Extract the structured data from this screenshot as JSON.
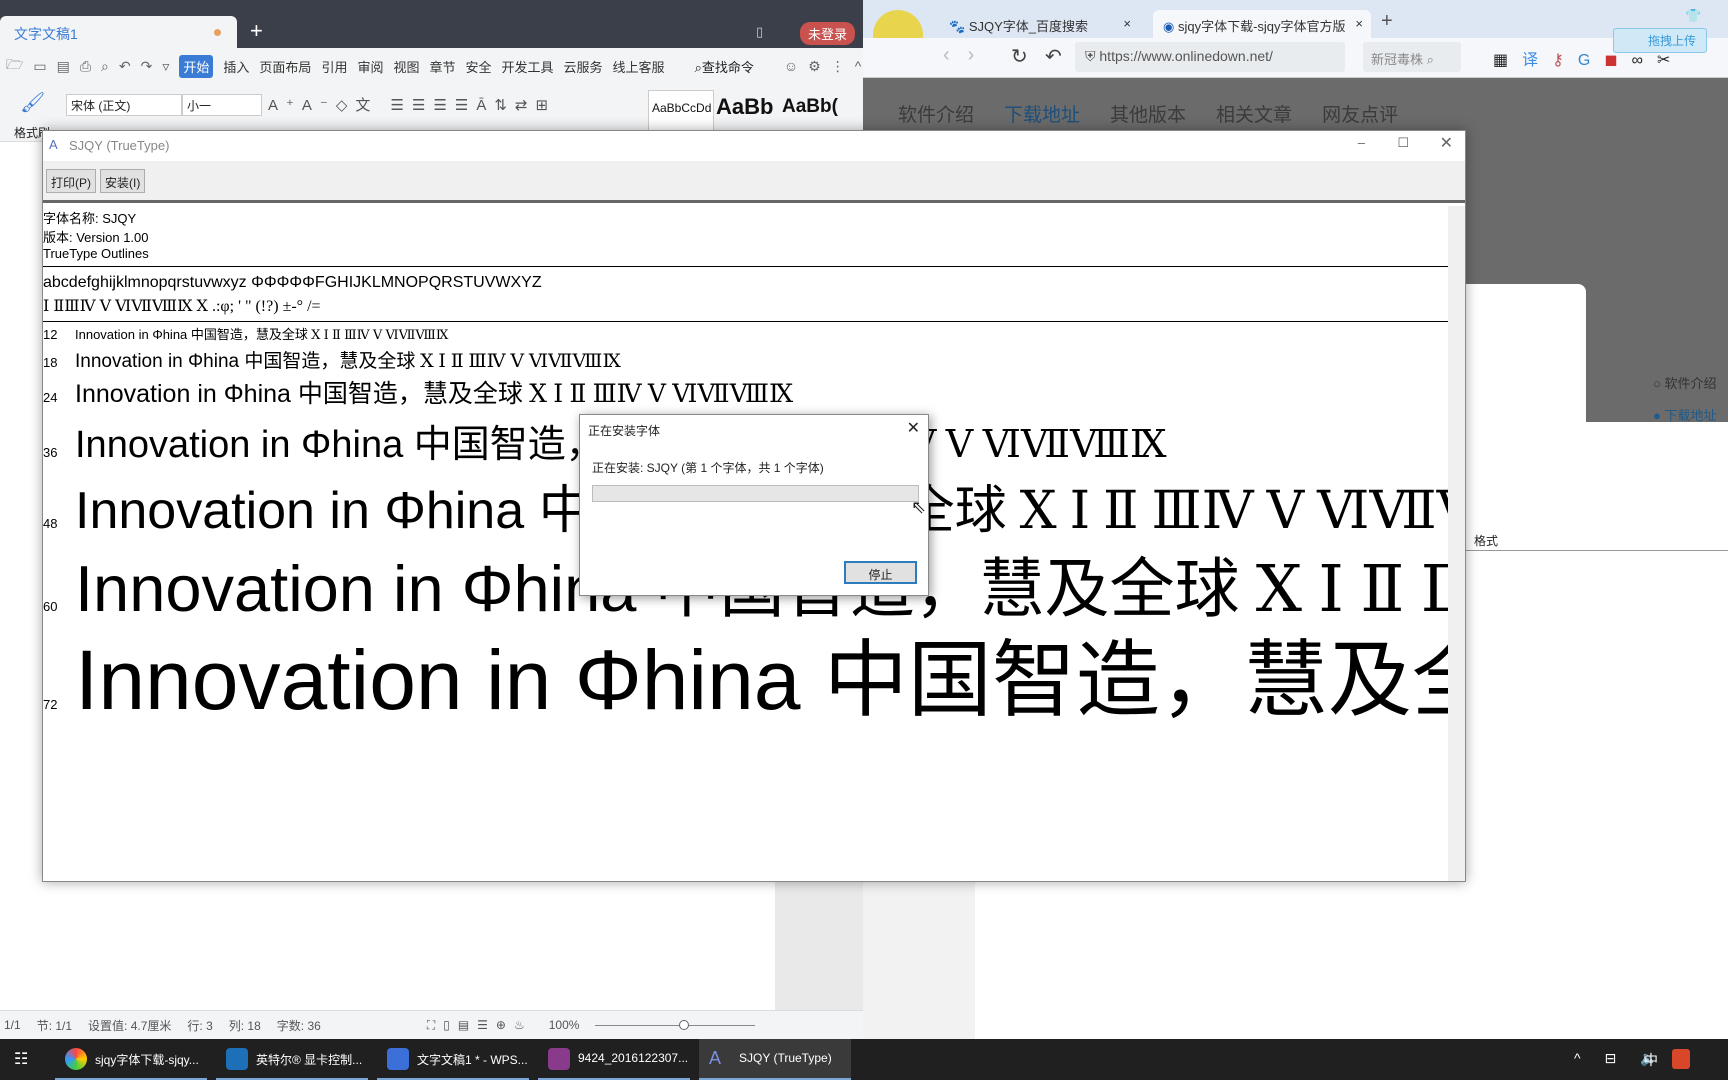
{
  "wps": {
    "tab_title": "文字文稿1",
    "login": "未登录",
    "menu": [
      "开始",
      "插入",
      "页面布局",
      "引用",
      "审阅",
      "视图",
      "章节",
      "安全",
      "开发工具",
      "云服务",
      "线上客服"
    ],
    "find_cmd": "查找命令",
    "font_name": "宋体 (正文)",
    "font_size": "小一",
    "format_painter": "格式刷",
    "styles": [
      "AaBbCcDd",
      "AaBb",
      "AaBb("
    ],
    "status": {
      "page": "1/1",
      "section": "节: 1/1",
      "setting": "设置值: 4.7厘米",
      "row": "行: 3",
      "col": "列: 18",
      "words": "字数: 36",
      "zoom": "100%"
    }
  },
  "browser": {
    "tabs": [
      {
        "title": "SJQY字体_百度搜索"
      },
      {
        "title": "sjqy字体下载-sjqy字体官方版"
      }
    ],
    "url": "https://www.onlinedown.net/",
    "search_placeholder": "新冠毒株",
    "upload": "拖拽上传",
    "nav": [
      "软件介绍",
      "下载地址",
      "其他版本",
      "相关文章",
      "网友点评"
    ],
    "timeline": [
      "软件介绍",
      "下载地址"
    ],
    "format_label": "格式"
  },
  "font_viewer": {
    "title": "SJQY (TrueType)",
    "print_btn": "打印(P)",
    "install_btn": "安装(I)",
    "font_name": "字体名称: SJQY",
    "version": "版本: Version 1.00",
    "outlines": "TrueType Outlines",
    "charset1": "abcdefghijklmnopqrstuvwxyz ΦΦΦΦΦFGHIJKLMNOPQRSTUVWXYZ",
    "charset2": "Ⅰ ⅡⅢⅣ Ⅴ ⅥⅦⅧⅨ Ⅹ .:φ; ' \" (!?) ±-°  /=",
    "sample_latin": "Innovation in Φhina ",
    "sample_cjk": "中国智造，慧及全球 ",
    "sample_roman": "Ⅹ Ⅰ Ⅱ ⅢⅣ Ⅴ ⅥⅦⅧⅨ",
    "sizes": [
      "12",
      "18",
      "24",
      "36",
      "48",
      "60",
      "72"
    ]
  },
  "dialog": {
    "title": "正在安装字体",
    "message": "正在安装: SJQY (第 1 个字体，共 1 个字体)",
    "progress": 0,
    "stop": "停止"
  },
  "taskbar": {
    "items": [
      "sjqy字体下载-sjqy...",
      "英特尔® 显卡控制...",
      "文字文稿1 * - WPS...",
      "9424_2016122307...",
      "SJQY (TrueType)"
    ],
    "ime": "中"
  }
}
